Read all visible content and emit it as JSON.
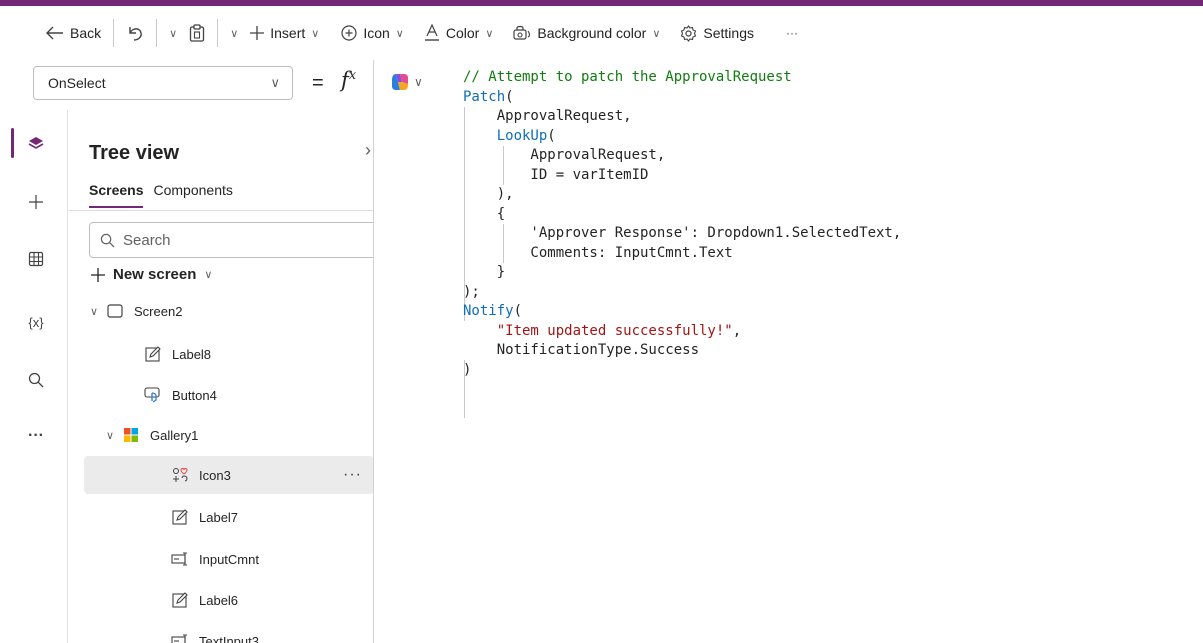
{
  "toolbar": {
    "back_label": "Back",
    "insert_label": "Insert",
    "icon_label": "Icon",
    "color_label": "Color",
    "background_color_label": "Background color",
    "settings_label": "Settings",
    "more_label": "···"
  },
  "formula_bar": {
    "property": "OnSelect",
    "equals": "=",
    "fx": "fx"
  },
  "code": {
    "line1": "// Attempt to patch the ApprovalRequest",
    "line2_kw": "Patch",
    "line2_rest": "(",
    "line3": "    ApprovalRequest,",
    "line4_kw": "LookUp",
    "line4_rest": "(",
    "line5": "        ApprovalRequest,",
    "line6": "        ID = varItemID",
    "line7": "    ),",
    "line8": "    {",
    "line9": "        'Approver Response': Dropdown1.SelectedText,",
    "line10": "        Comments: InputCmnt.Text",
    "line11": "    }",
    "line12": ");",
    "line13_kw": "Notify",
    "line13_rest": "(",
    "line14_str": "\"Item updated successfully!\"",
    "line14_rest": ",",
    "line15": "    NotificationType.Success",
    "line16": ")"
  },
  "rail": {
    "vars_label": "{x}",
    "more_label": "···"
  },
  "tree": {
    "title": "Tree view",
    "tab_screens": "Screens",
    "tab_components": "Components",
    "search_placeholder": "Search",
    "new_screen_label": "New screen",
    "items": [
      {
        "label": "Screen2"
      },
      {
        "label": "Label8"
      },
      {
        "label": "Button4"
      },
      {
        "label": "Gallery1"
      },
      {
        "label": "Icon3"
      },
      {
        "label": "Label7"
      },
      {
        "label": "InputCmnt"
      },
      {
        "label": "Label6"
      },
      {
        "label": "TextInput3"
      }
    ],
    "row_more": "···"
  },
  "colors": {
    "accent": "#742774",
    "keyword": "#0e6eb8",
    "comment": "#107c10",
    "string": "#a31515"
  }
}
